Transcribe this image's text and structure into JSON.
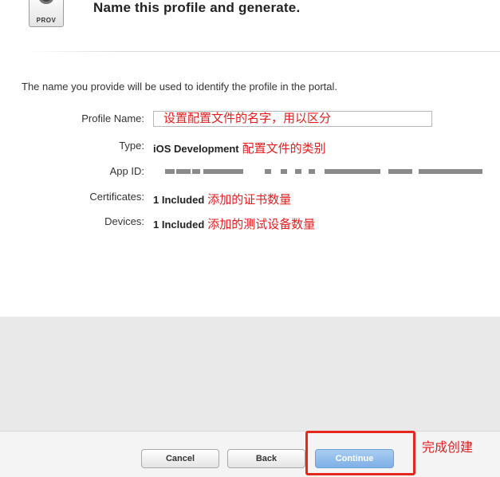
{
  "header": {
    "icon_label": "PROV",
    "title": "Name this profile and generate."
  },
  "intro": "The name you provide will be used to identify the profile in the portal.",
  "fields": {
    "profile_name": {
      "label": "Profile Name:",
      "value": "设置配置文件的名字，用以区分"
    },
    "type": {
      "label": "Type:",
      "value": "iOS Development",
      "note": "配置文件的类别"
    },
    "app_id": {
      "label": "App ID:"
    },
    "certificates": {
      "label": "Certificates:",
      "value": "1 Included",
      "note": "添加的证书数量"
    },
    "devices": {
      "label": "Devices:",
      "value": "1 Included",
      "note": "添加的测试设备数量"
    }
  },
  "buttons": {
    "cancel": "Cancel",
    "back": "Back",
    "continue": "Continue"
  },
  "annotation": {
    "finish": "完成创建"
  },
  "colors": {
    "annotation_red": "#e51d1d",
    "continue_blue": "#7eafe6"
  }
}
